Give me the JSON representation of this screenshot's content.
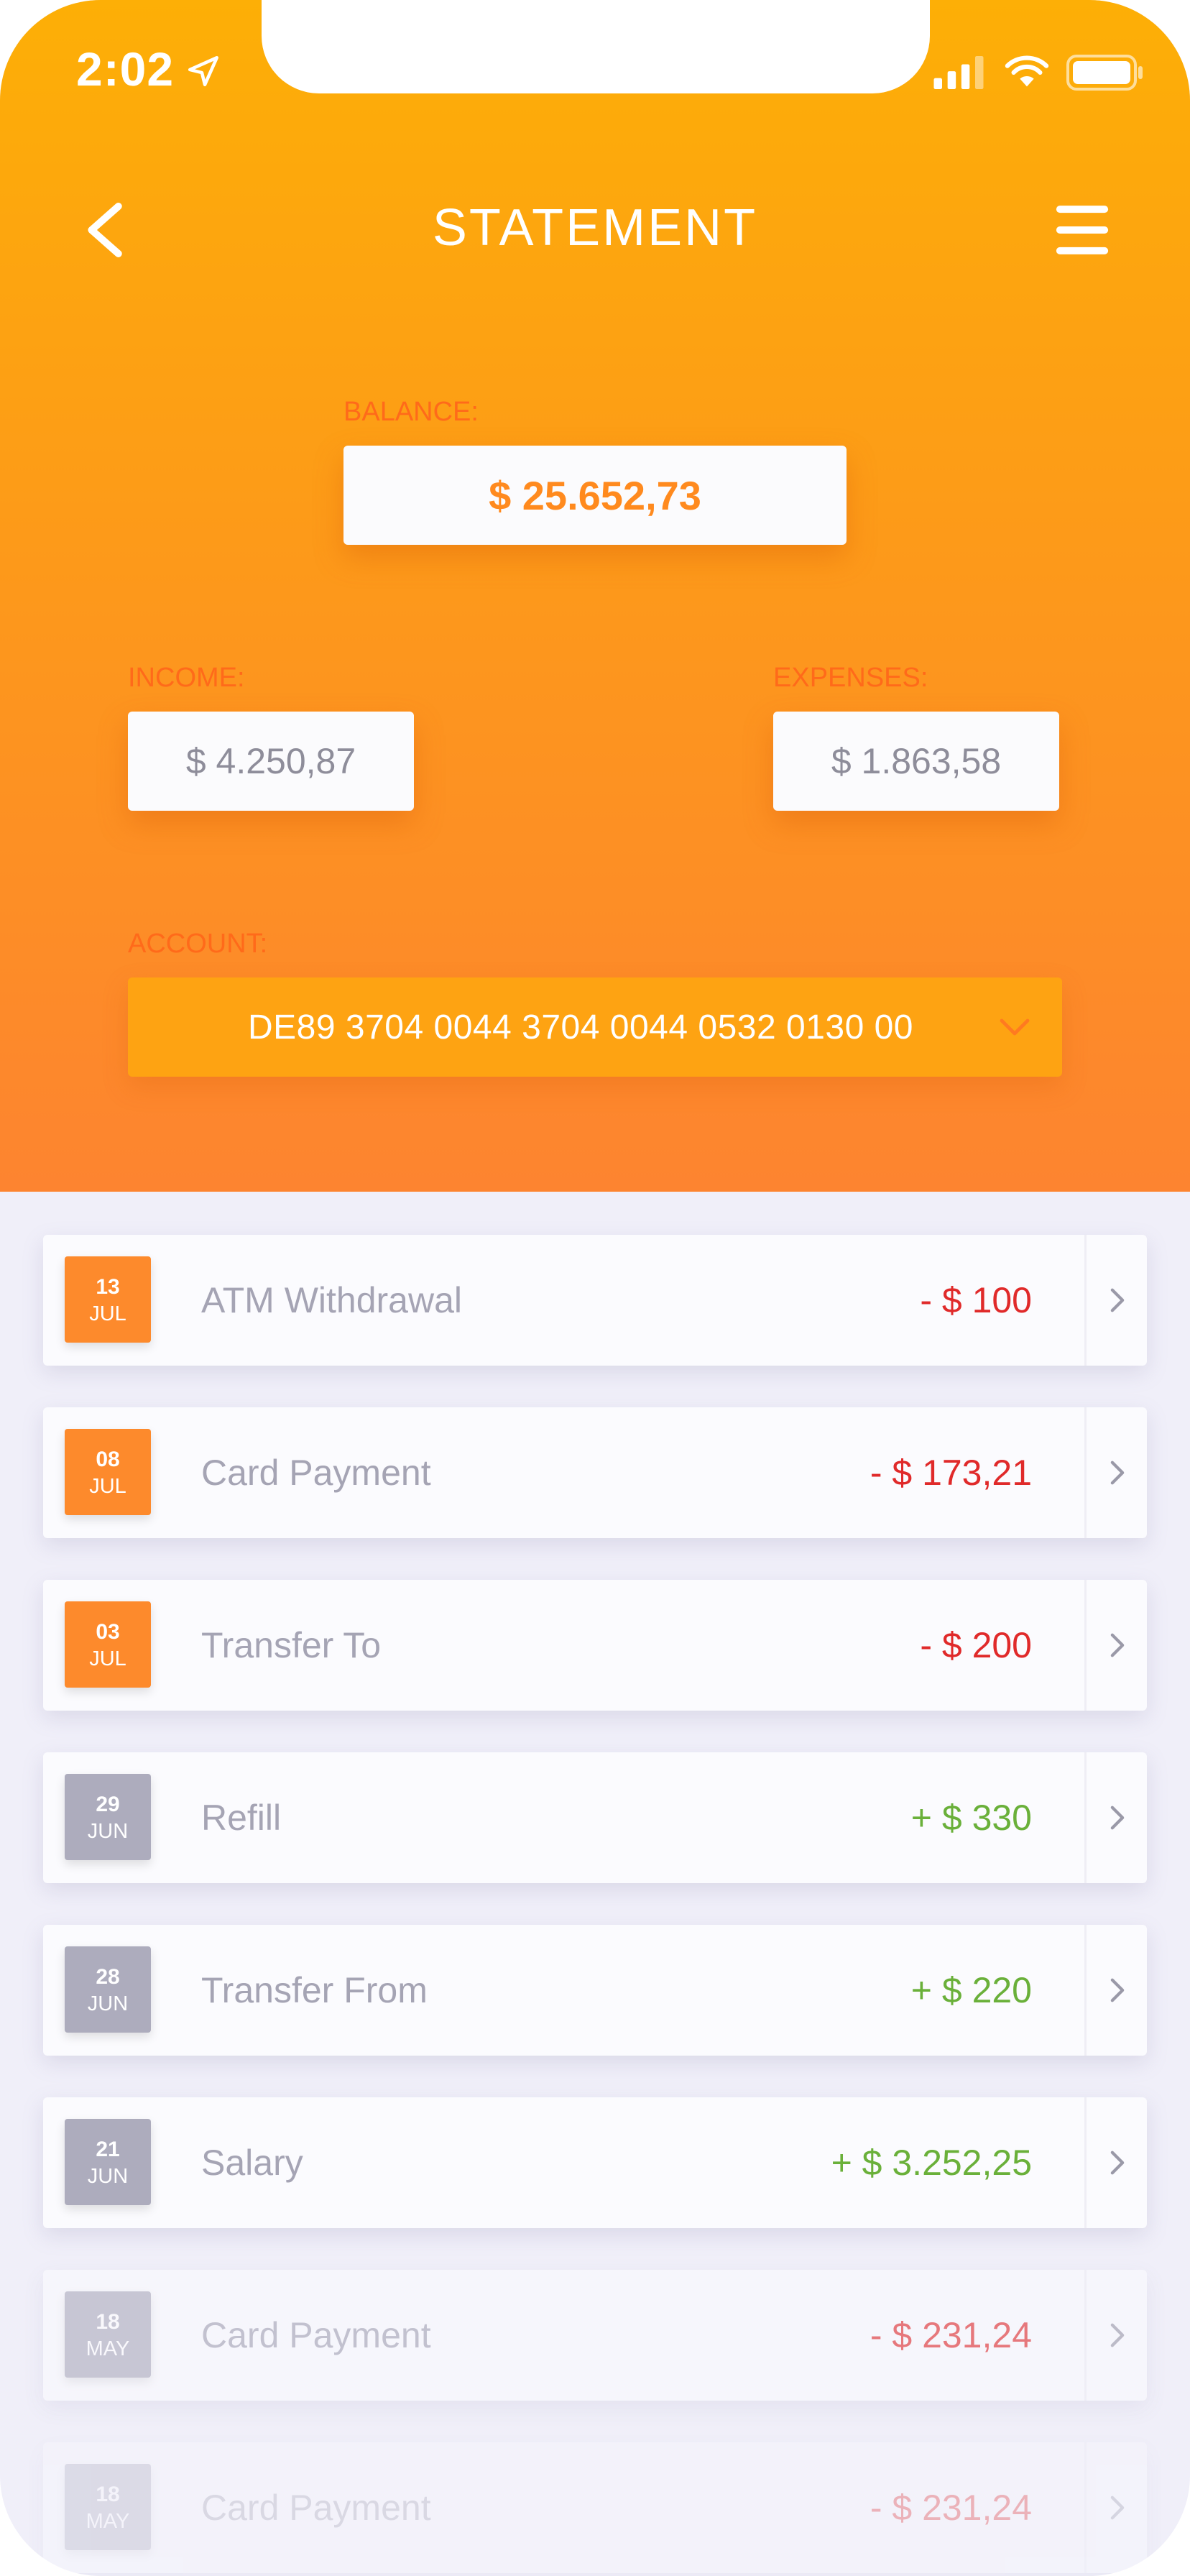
{
  "status_bar": {
    "time": "2:02"
  },
  "header": {
    "title": "STATEMENT"
  },
  "balance": {
    "label": "BALANCE:",
    "value": "$ 25.652,73"
  },
  "income": {
    "label": "INCOME:",
    "value": "$ 4.250,87"
  },
  "expenses": {
    "label": "EXPENSES:",
    "value": "$ 1.863,58"
  },
  "account": {
    "label": "ACCOUNT:",
    "value": "DE89 3704 0044 3704 0044 0532 0130 00"
  },
  "colors": {
    "header_top": "#fdaf06",
    "header_bottom": "#fd8430",
    "label_orange": "#ff6a1a",
    "negative": "#e02a2a",
    "positive": "#6ab03a",
    "badge_recent": "#fd8a2c",
    "badge_old": "#adacbd"
  },
  "transactions": [
    {
      "day": "13",
      "month": "JUL",
      "title": "ATM Withdrawal",
      "amount": "- $ 100"
    },
    {
      "day": "08",
      "month": "JUL",
      "title": "Card Payment",
      "amount": "- $ 173,21"
    },
    {
      "day": "03",
      "month": "JUL",
      "title": "Transfer To",
      "amount": "- $ 200"
    },
    {
      "day": "29",
      "month": "JUN",
      "title": "Refill",
      "amount": "+ $ 330"
    },
    {
      "day": "28",
      "month": "JUN",
      "title": "Transfer From",
      "amount": "+ $ 220"
    },
    {
      "day": "21",
      "month": "JUN",
      "title": "Salary",
      "amount": "+ $ 3.252,25"
    },
    {
      "day": "18",
      "month": "MAY",
      "title": "Card Payment",
      "amount": "- $ 231,24"
    },
    {
      "day": "18",
      "month": "MAY",
      "title": "Card Payment",
      "amount": "- $ 231,24"
    }
  ],
  "icons": {
    "back": "chevron-left-icon",
    "menu": "hamburger-menu-icon",
    "dropdown": "chevron-down-icon",
    "row": "chevron-right-icon"
  }
}
